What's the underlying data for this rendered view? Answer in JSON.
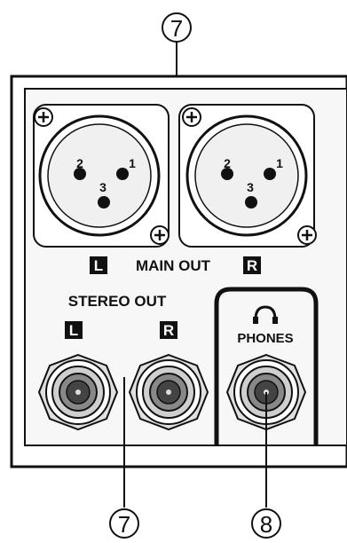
{
  "callouts": {
    "top": "7",
    "bottom_left": "7",
    "bottom_right": "8"
  },
  "main_out": {
    "label": "MAIN OUT",
    "left_badge": "L",
    "right_badge": "R"
  },
  "xlr_pins": {
    "pin1": "1",
    "pin2": "2",
    "pin3": "3"
  },
  "stereo_out": {
    "label": "STEREO OUT",
    "left_badge": "L",
    "right_badge": "R"
  },
  "phones": {
    "label": "PHONES",
    "icon": "headphones-icon"
  },
  "colors": {
    "ink": "#111111",
    "panel": "#f7f7f7",
    "jack_fill": "#cfcfcf",
    "jack_dark": "#444444"
  }
}
